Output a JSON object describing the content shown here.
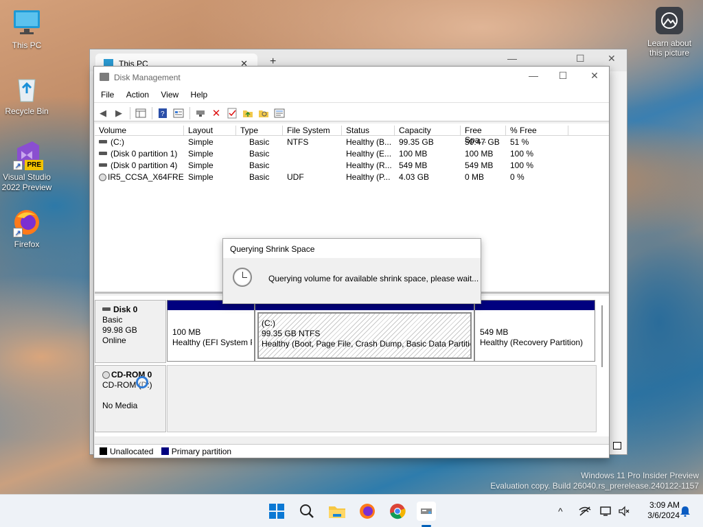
{
  "desktop": {
    "icons": [
      {
        "label": "This PC"
      },
      {
        "label": "Recycle Bin"
      },
      {
        "label": "Visual Studio 2022 Preview",
        "badge": "PRE"
      },
      {
        "label": "Firefox"
      }
    ],
    "learn_about": "Learn about this picture"
  },
  "explorer": {
    "tab_title": "This PC",
    "tab_close": "✕",
    "new_tab": "+",
    "minimize": "—",
    "maximize": "☐",
    "close": "✕"
  },
  "disk_management": {
    "title": "Disk Management",
    "window_controls": {
      "minimize": "—",
      "maximize": "☐",
      "close": "✕"
    },
    "menu": [
      "File",
      "Action",
      "View",
      "Help"
    ],
    "columns": [
      "Volume",
      "Layout",
      "Type",
      "File System",
      "Status",
      "Capacity",
      "Free Spa...",
      "% Free"
    ],
    "volumes": [
      {
        "volume": "(C:)",
        "layout": "Simple",
        "type": "Basic",
        "fs": "NTFS",
        "status": "Healthy (B...",
        "capacity": "99.35 GB",
        "free": "50.47 GB",
        "pct": "51 %"
      },
      {
        "volume": "(Disk 0 partition 1)",
        "layout": "Simple",
        "type": "Basic",
        "fs": "",
        "status": "Healthy (E...",
        "capacity": "100 MB",
        "free": "100 MB",
        "pct": "100 %"
      },
      {
        "volume": "(Disk 0 partition 4)",
        "layout": "Simple",
        "type": "Basic",
        "fs": "",
        "status": "Healthy (R...",
        "capacity": "549 MB",
        "free": "549 MB",
        "pct": "100 %"
      },
      {
        "volume": "IR5_CCSA_X64FRE...",
        "layout": "Simple",
        "type": "Basic",
        "fs": "UDF",
        "status": "Healthy (P...",
        "capacity": "4.03 GB",
        "free": "0 MB",
        "pct": "0 %"
      }
    ],
    "disk0": {
      "name": "Disk 0",
      "type": "Basic",
      "size": "99.98 GB",
      "state": "Online",
      "partitions": [
        {
          "line1": "100 MB",
          "line2": "Healthy (EFI System P"
        },
        {
          "title": "(C:)",
          "line1": "99.35 GB NTFS",
          "line2": "Healthy (Boot, Page File, Crash Dump, Basic Data Partition"
        },
        {
          "line1": "549 MB",
          "line2": "Healthy (Recovery Partition)"
        }
      ]
    },
    "cdrom": {
      "name": "CD-ROM 0",
      "type": "CD-ROM (D:)",
      "media": "No Media"
    },
    "legend": [
      {
        "label": "Unallocated",
        "color": "#000000"
      },
      {
        "label": "Primary partition",
        "color": "#00007f"
      }
    ]
  },
  "dialog": {
    "title": "Querying Shrink Space",
    "message": "Querying volume for available shrink space, please wait..."
  },
  "watermark": {
    "line1": "Windows 11 Pro Insider Preview",
    "line2": "Evaluation copy. Build 26040.rs_prerelease.240122-1157"
  },
  "taskbar": {
    "time": "3:09 AM",
    "date": "3/6/2024",
    "tray_chevron": "^"
  }
}
